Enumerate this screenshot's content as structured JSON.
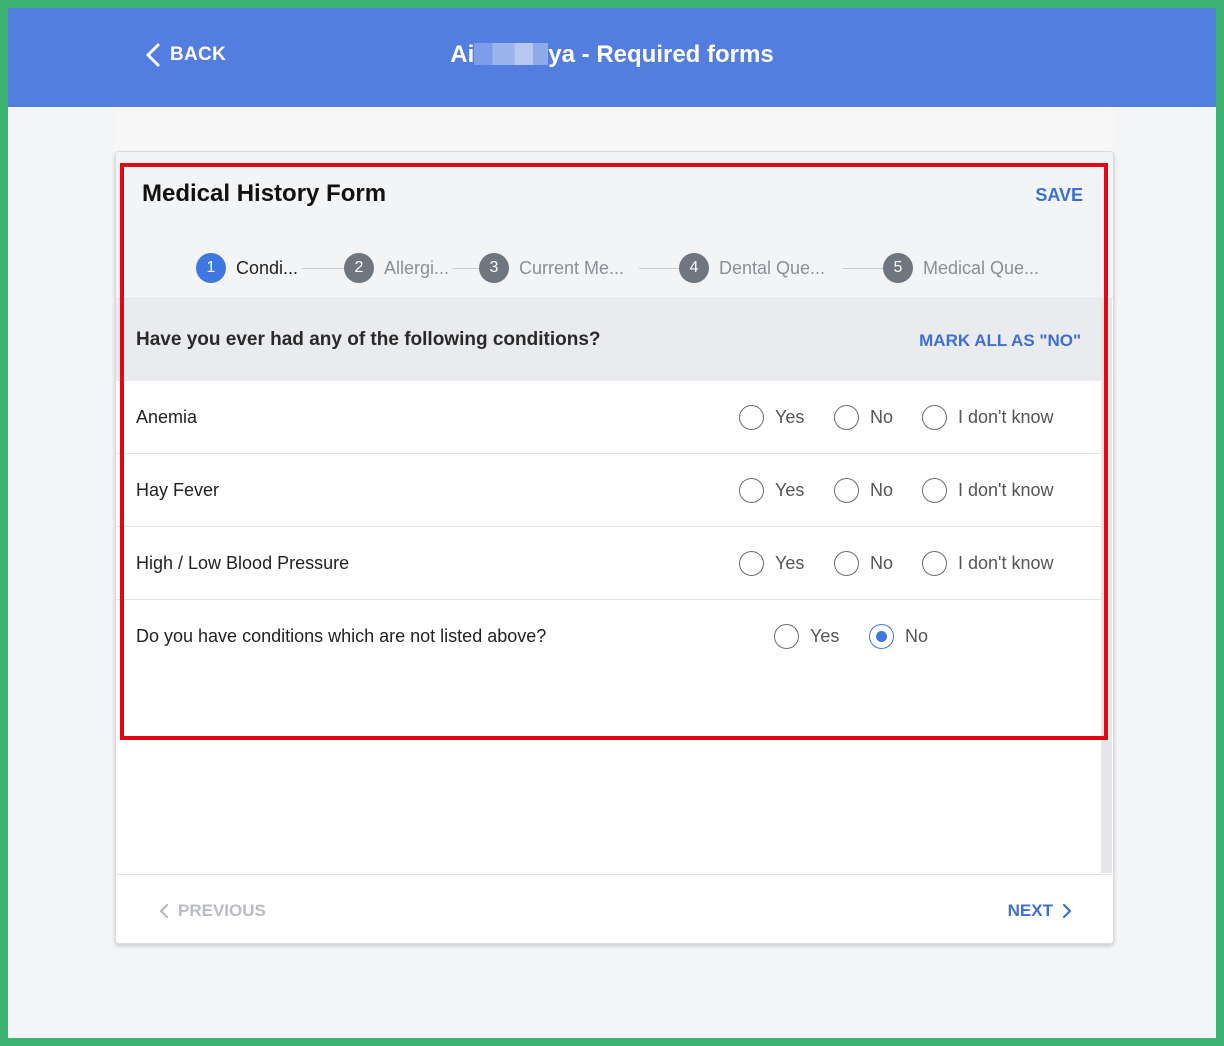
{
  "header": {
    "back_label": "BACK",
    "title_prefix": "Ai",
    "title_suffix": "ya - Required forms"
  },
  "form": {
    "title": "Medical History Form",
    "save_label": "SAVE"
  },
  "stepper": {
    "steps": [
      {
        "number": "1",
        "label": "Condi...",
        "active": true
      },
      {
        "number": "2",
        "label": "Allergi...",
        "active": false
      },
      {
        "number": "3",
        "label": "Current Me...",
        "active": false
      },
      {
        "number": "4",
        "label": "Dental Que...",
        "active": false
      },
      {
        "number": "5",
        "label": "Medical Que...",
        "active": false
      }
    ]
  },
  "section": {
    "question": "Have you ever had any of the following conditions?",
    "mark_all_label": "MARK ALL AS \"NO\""
  },
  "conditions": [
    {
      "label": "Anemia",
      "options": [
        "Yes",
        "No",
        "I don't know"
      ],
      "selected": null
    },
    {
      "label": "Hay Fever",
      "options": [
        "Yes",
        "No",
        "I don't know"
      ],
      "selected": null
    },
    {
      "label": "High / Low Blood Pressure",
      "options": [
        "Yes",
        "No",
        "I don't know"
      ],
      "selected": null
    },
    {
      "label": "Do you have conditions which are not listed above?",
      "options": [
        "Yes",
        "No"
      ],
      "selected": "No"
    }
  ],
  "footer": {
    "previous_label": "PREVIOUS",
    "next_label": "NEXT"
  },
  "colors": {
    "header_bg": "#547de0",
    "accent": "#3c6fd6",
    "highlight_border": "#e30613",
    "outer_frame": "#3cb371"
  }
}
